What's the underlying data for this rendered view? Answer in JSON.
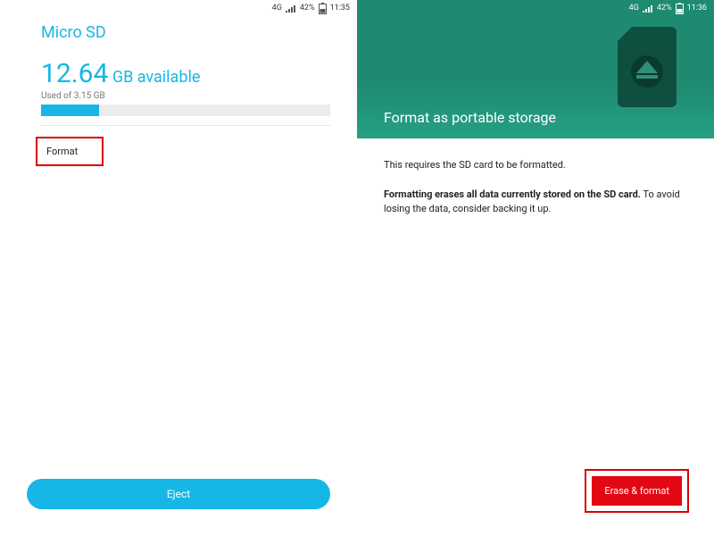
{
  "left": {
    "status": {
      "net": "4G",
      "battery_pct": "42%",
      "time": "11:35"
    },
    "title": "Micro SD",
    "available_value": "12.64",
    "available_suffix": " GB available",
    "used_text": "Used of 3.15 GB",
    "format_label": "Format",
    "eject_label": "Eject",
    "bar_fill_pct": 20
  },
  "right": {
    "status": {
      "net": "4G",
      "battery_pct": "42%",
      "time": "11:36"
    },
    "hero_title": "Format as portable storage",
    "para1": "This requires the SD card to be formatted.",
    "para2_bold": "Formatting erases all data currently stored on the SD card.",
    "para2_rest": " To avoid losing the data, consider backing it up.",
    "erase_label": "Erase & format"
  },
  "colors": {
    "accent_cyan": "#16b7e6",
    "accent_teal": "#1e8a71",
    "highlight_red": "#d80000",
    "button_red": "#e30613"
  }
}
